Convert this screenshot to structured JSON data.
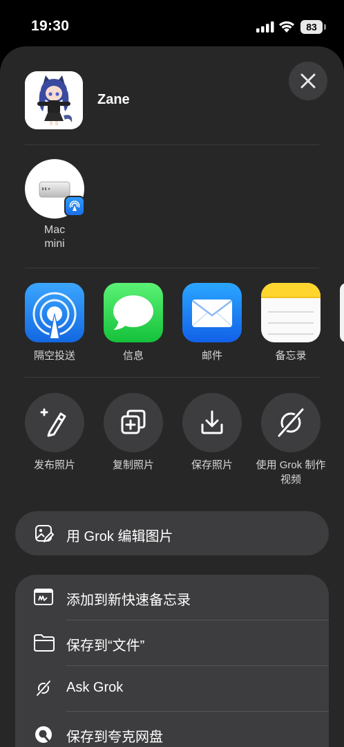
{
  "status": {
    "time": "19:30",
    "battery": "83"
  },
  "header": {
    "name": "Zane"
  },
  "device": {
    "line1": "Mac",
    "line2": "mini"
  },
  "apps": [
    {
      "label": "隔空投送",
      "icon": "airdrop-icon"
    },
    {
      "label": "信息",
      "icon": "messages-icon"
    },
    {
      "label": "邮件",
      "icon": "mail-icon"
    },
    {
      "label": "备忘录",
      "icon": "notes-icon"
    }
  ],
  "actions": [
    {
      "label": "发布照片",
      "icon": "post-photo-icon"
    },
    {
      "label": "复制照片",
      "icon": "copy-photo-icon"
    },
    {
      "label": "保存照片",
      "icon": "save-photo-icon"
    },
    {
      "label_line1": "使用 Grok 制作",
      "label_line2": "视频",
      "icon": "grok-icon"
    }
  ],
  "pill": {
    "label": "用 Grok 编辑图片",
    "icon": "edit-image-icon"
  },
  "list": [
    {
      "label": "添加到新快速备忘录",
      "icon": "quick-note-icon"
    },
    {
      "label": "保存到“文件”",
      "icon": "folder-icon"
    },
    {
      "label": "Ask Grok",
      "icon": "grok-icon"
    },
    {
      "label": "保存到夸克网盘",
      "icon": "quark-icon"
    }
  ]
}
